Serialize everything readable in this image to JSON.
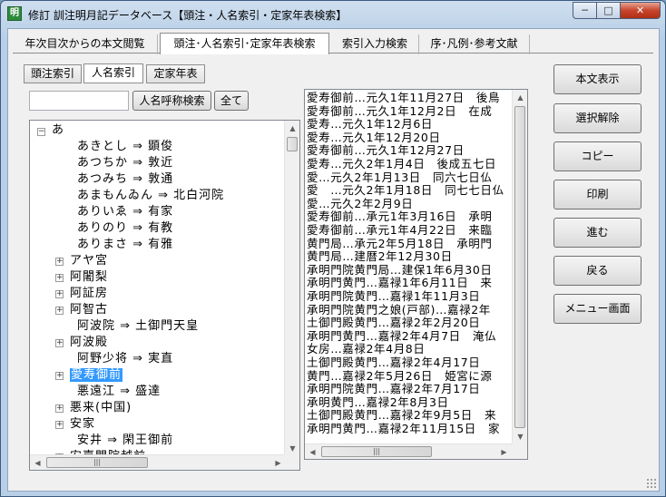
{
  "window": {
    "app_icon_text": "明",
    "title": "修訂 訓注明月記データベース【頭注・人名索引・定家年表検索】",
    "minimize_glyph": "─",
    "maximize_glyph": "□",
    "close_glyph": "✕"
  },
  "main_tabs": [
    {
      "label": "年次目次からの本文閲覧"
    },
    {
      "label": "頭注･人名索引･定家年表検索"
    },
    {
      "label": "索引入力検索"
    },
    {
      "label": "序･凡例･参考文献"
    }
  ],
  "sub_tabs": [
    {
      "label": "頭注索引"
    },
    {
      "label": "人名索引"
    },
    {
      "label": "定家年表"
    }
  ],
  "search": {
    "value": "",
    "placeholder": "",
    "search_button": "人名呼称検索",
    "all_button": "全て"
  },
  "tree": {
    "root": "あ",
    "items": [
      {
        "text": "あきとし ⇒ 顕俊",
        "expand": ""
      },
      {
        "text": "あつちか ⇒ 敦近",
        "expand": ""
      },
      {
        "text": "あつみち ⇒ 敦通",
        "expand": ""
      },
      {
        "text": "あまもんゐん ⇒ 北白河院",
        "expand": ""
      },
      {
        "text": "ありいゑ ⇒ 有家",
        "expand": ""
      },
      {
        "text": "ありのり ⇒ 有教",
        "expand": ""
      },
      {
        "text": "ありまさ ⇒ 有雅",
        "expand": ""
      },
      {
        "text": "アヤ宮",
        "expand": "+"
      },
      {
        "text": "阿闍梨",
        "expand": "+"
      },
      {
        "text": "阿証房",
        "expand": "+"
      },
      {
        "text": "阿智古",
        "expand": "+"
      },
      {
        "text": "阿波院 ⇒ 土御門天皇",
        "expand": ""
      },
      {
        "text": "阿波殿",
        "expand": "+"
      },
      {
        "text": "阿野少将 ⇒ 実直",
        "expand": ""
      },
      {
        "text": "愛寿御前",
        "expand": "+"
      },
      {
        "text": "悪遠江 ⇒ 盛達",
        "expand": ""
      },
      {
        "text": "悪来(中国)",
        "expand": "+"
      },
      {
        "text": "安家",
        "expand": "+"
      },
      {
        "text": "安井 ⇒ 閑王御前",
        "expand": ""
      },
      {
        "text": "安嘉門院越前",
        "expand": "+"
      }
    ],
    "selected_item": "愛寿御前"
  },
  "result_list": [
    "愛寿御前…元久1年11月27日　後鳥",
    "愛寿御前…元久1年12月2日　在成",
    "愛寿…元久1年12月6日",
    "愛寿…元久1年12月20日",
    "愛寿御前…元久1年12月27日",
    "愛寿…元久2年1月4日　後成五七日",
    "愛…元久2年1月13日　同六七日仏",
    "愛　…元久2年1月18日　同七七日仏",
    "愛…元久2年2月9日",
    "愛寿御前…承元1年3月16日　承明",
    "愛寿御前…承元1年4月22日　来臨",
    "黄門局…承元2年5月18日　承明門",
    "黄門局…建暦2年12月30日",
    "承明門院黄門局…建保1年6月30日",
    "承明門黄門…嘉禄1年6月11日　来",
    "承明門院黄門…嘉禄1年11月3日",
    "承明門院黄門之娘(戸部)…嘉禄2年",
    "土御門殿黄門…嘉禄2年2月20日",
    "承明門黄門…嘉禄2年4月7日　淹仏",
    "女房…嘉禄2年4月8日",
    "土御門殿黄門…嘉禄2年4月17日",
    "黄門…嘉禄2年5月26日　姫宮に源",
    "承明門院黄門…嘉禄2年7月17日",
    "承明黄門…嘉禄2年8月3日",
    "土御門殿黄門…嘉禄2年9月5日　来",
    "承明門黄門…嘉禄2年11月15日　家"
  ],
  "actions": {
    "show_text": "本文表示",
    "clear_selection": "選択解除",
    "copy": "コピー",
    "print": "印刷",
    "forward": "進む",
    "back": "戻る",
    "menu": "メニュー画面"
  },
  "scroll_glyphs": {
    "up": "▲",
    "down": "▼",
    "left": "◀",
    "right": "▶",
    "grip": "|||"
  }
}
